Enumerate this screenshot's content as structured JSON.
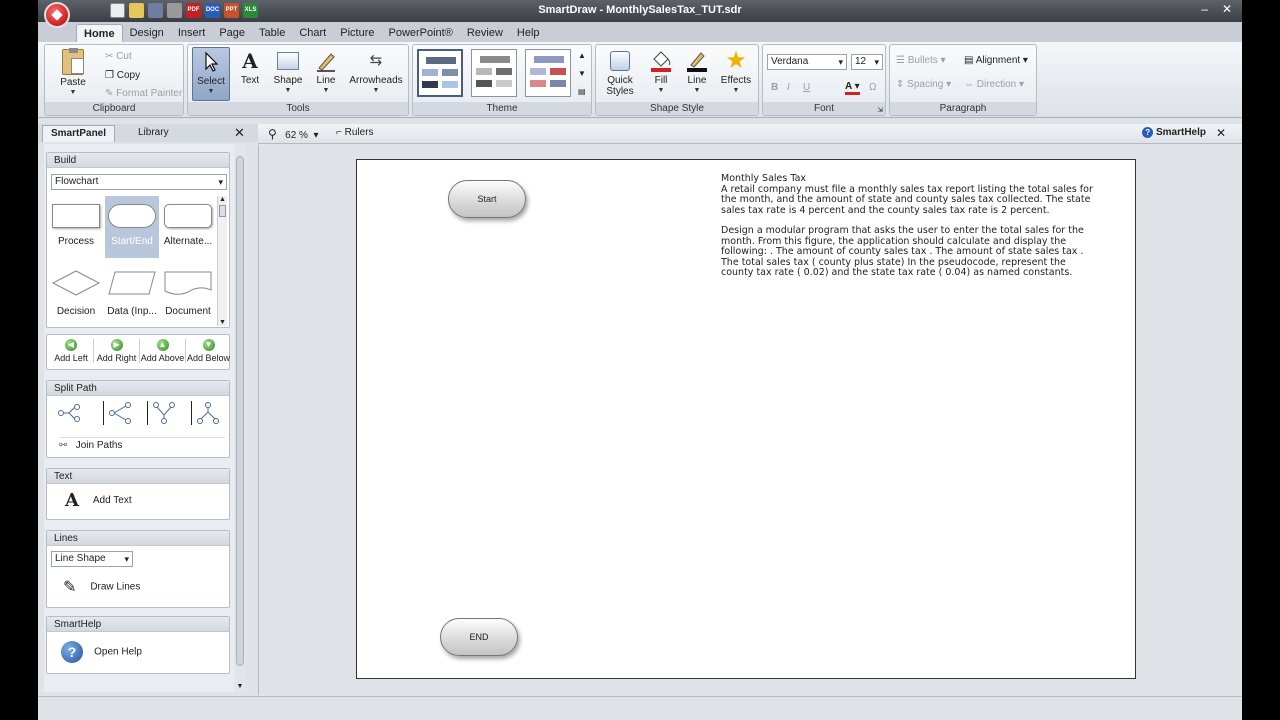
{
  "window": {
    "title": "SmartDraw - MonthlySalesTax_TUT.sdr",
    "controls": [
      "–",
      "✕"
    ]
  },
  "qat": [
    "PDF",
    "DOC",
    "PPT",
    "XLS"
  ],
  "ribbon_tabs": [
    "Home",
    "Design",
    "Insert",
    "Page",
    "Table",
    "Chart",
    "Picture",
    "PowerPoint®",
    "Review",
    "Help"
  ],
  "clipboard": {
    "paste": "Paste",
    "cut": "Cut",
    "copy": "Copy",
    "format_painter": "Format Painter",
    "label": "Clipboard"
  },
  "tools": {
    "select": "Select",
    "text": "Text",
    "shape": "Shape",
    "line": "Line",
    "arrowheads": "Arrowheads",
    "label": "Tools"
  },
  "theme": {
    "label": "Theme"
  },
  "shape_style": {
    "quick_styles": "Quick Styles",
    "fill": "Fill",
    "line": "Line",
    "effects": "Effects",
    "label": "Shape Style"
  },
  "font": {
    "name": "Verdana",
    "size": "12",
    "bold": "B",
    "italic": "I",
    "underline": "U",
    "label": "Font"
  },
  "paragraph": {
    "bullets": "Bullets",
    "alignment": "Alignment",
    "spacing": "Spacing",
    "direction": "Direction",
    "label": "Paragraph"
  },
  "panel": {
    "tabs": [
      "SmartPanel",
      "Library"
    ],
    "build": {
      "title": "Build",
      "dropdown": "Flowchart",
      "shapes": [
        "Process",
        "Start/End",
        "Alternate...",
        "Decision",
        "Data (Inp...",
        "Document"
      ],
      "add": [
        "Add Left",
        "Add Right",
        "Add Above",
        "Add Below"
      ]
    },
    "split_path": {
      "title": "Split Path",
      "join": "Join Paths"
    },
    "text": {
      "title": "Text",
      "add": "Add Text"
    },
    "lines": {
      "title": "Lines",
      "dropdown": "Line Shape",
      "draw": "Draw Lines"
    },
    "smarthelp": {
      "title": "SmartHelp",
      "open": "Open Help"
    }
  },
  "canvas_toolbar": {
    "zoom": "62 %",
    "rulers": "Rulers",
    "smarthelp": "SmartHelp"
  },
  "diagram": {
    "start": "Start",
    "end": "END",
    "text_title": "Monthly Sales Tax",
    "para1": "A retail company must file a monthly sales tax report listing the total sales for the month, and the amount of state and county sales tax collected. The state sales tax rate is 4 percent and the county sales tax rate is 2 percent.",
    "para2": "Design a modular program that asks the user to enter the total sales for the month. From this figure, the application should calculate and display the following: . The amount of county sales tax . The amount of state sales tax . The total sales tax ( county plus state) In the pseudocode, represent the county tax rate ( 0.02) and the state tax rate ( 0.04) as named constants."
  }
}
